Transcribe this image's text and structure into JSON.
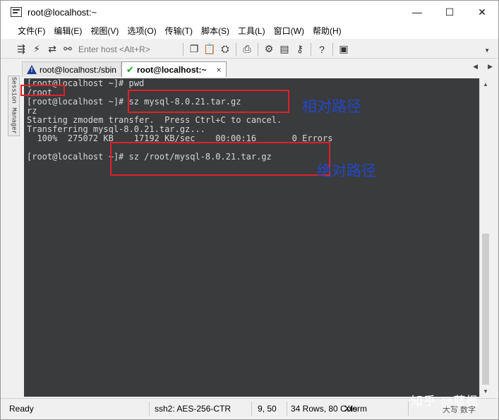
{
  "window": {
    "title": "root@localhost:~"
  },
  "window_controls": {
    "minimize": "—",
    "maximize": "☐",
    "close": "✕"
  },
  "menu": [
    "文件(F)",
    "编辑(E)",
    "视图(V)",
    "选项(O)",
    "传输(T)",
    "脚本(S)",
    "工具(L)",
    "窗口(W)",
    "帮助(H)"
  ],
  "toolbar": {
    "host_placeholder": "Enter host <Alt+R>"
  },
  "session_manager": {
    "label": "Session Manager"
  },
  "tabs": [
    {
      "label": "root@localhost:/sbin",
      "status": "warning"
    },
    {
      "label": "root@localhost:~",
      "status": "connected",
      "close": "×"
    }
  ],
  "terminal": {
    "lines": [
      "[root@localhost ~]# pwd",
      "/root",
      "[root@localhost ~]# sz mysql-8.0.21.tar.gz",
      "rz",
      "Starting zmodem transfer.  Press Ctrl+C to cancel.",
      "Transferring mysql-8.0.21.tar.gz...",
      "  100%  275072 KB    17192 KB/sec    00:00:16       0 Errors",
      "",
      "[root@localhost ~]# sz /root/mysql-8.0.21.tar.gz"
    ]
  },
  "annotations": {
    "relative_path": "相对路径",
    "absolute_path": "绝对路径"
  },
  "status": {
    "ready": "Ready",
    "cipher": "ssh2: AES-256-CTR",
    "cursor": "9,  50",
    "size": "34 Rows, 80 Cols",
    "terminal_type": "Xterm",
    "input_mode": "大写 数字"
  },
  "watermark": "知乎 @蓝枫",
  "colors": {
    "terminal_bg": "#3a3b3d",
    "terminal_fg": "#d7d7d7",
    "annotation_box": "#e0202a",
    "annotation_text": "#2347c4"
  }
}
